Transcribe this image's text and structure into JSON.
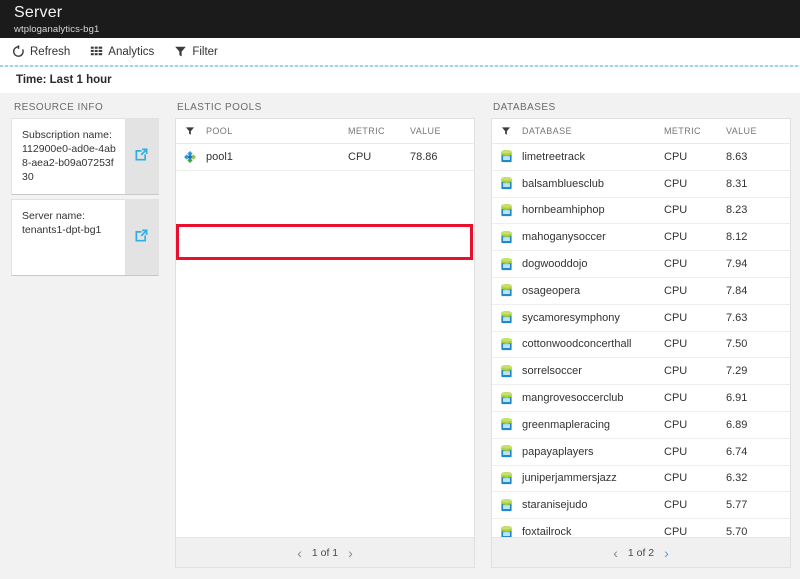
{
  "header": {
    "title": "Server",
    "subtitle": "wtploganalytics-bg1"
  },
  "toolbar": {
    "refresh_label": "Refresh",
    "analytics_label": "Analytics",
    "filter_label": "Filter"
  },
  "timebar": {
    "time_label": "Time: Last 1 hour"
  },
  "resource_info": {
    "section_title": "RESOURCE INFO",
    "cards": [
      {
        "label": "Subscription name:",
        "value": "112900e0-ad0e-4ab8-aea2-b09a07253f30",
        "action_icon": "external-link-icon"
      },
      {
        "label": "Server name:",
        "value": "tenants1-dpt-bg1",
        "action_icon": "external-link-icon"
      }
    ]
  },
  "elastic_pools": {
    "section_title": "ELASTIC POOLS",
    "columns": [
      "POOL",
      "METRIC",
      "VALUE"
    ],
    "filter_icon": "filter-icon",
    "rows": [
      {
        "icon": "elastic-pool-icon",
        "name": "pool1",
        "metric": "CPU",
        "value": "78.86"
      }
    ],
    "pager": {
      "prev_icon": "chevron-left-icon",
      "label": "1 of 1",
      "next_icon": "chevron-right-icon"
    },
    "highlight_color": "#e8112d"
  },
  "databases": {
    "section_title": "DATABASES",
    "columns": [
      "DATABASE",
      "METRIC",
      "VALUE"
    ],
    "filter_icon": "filter-icon",
    "rows": [
      {
        "icon": "database-icon",
        "name": "limetreetrack",
        "metric": "CPU",
        "value": "8.63"
      },
      {
        "icon": "database-icon",
        "name": "balsambluesclub",
        "metric": "CPU",
        "value": "8.31"
      },
      {
        "icon": "database-icon",
        "name": "hornbeamhiphop",
        "metric": "CPU",
        "value": "8.23"
      },
      {
        "icon": "database-icon",
        "name": "mahoganysoccer",
        "metric": "CPU",
        "value": "8.12"
      },
      {
        "icon": "database-icon",
        "name": "dogwooddojo",
        "metric": "CPU",
        "value": "7.94"
      },
      {
        "icon": "database-icon",
        "name": "osageopera",
        "metric": "CPU",
        "value": "7.84"
      },
      {
        "icon": "database-icon",
        "name": "sycamoresymphony",
        "metric": "CPU",
        "value": "7.63"
      },
      {
        "icon": "database-icon",
        "name": "cottonwoodconcerthall",
        "metric": "CPU",
        "value": "7.50"
      },
      {
        "icon": "database-icon",
        "name": "sorrelsoccer",
        "metric": "CPU",
        "value": "7.29"
      },
      {
        "icon": "database-icon",
        "name": "mangrovesoccerclub",
        "metric": "CPU",
        "value": "6.91"
      },
      {
        "icon": "database-icon",
        "name": "greenmapleracing",
        "metric": "CPU",
        "value": "6.89"
      },
      {
        "icon": "database-icon",
        "name": "papayaplayers",
        "metric": "CPU",
        "value": "6.74"
      },
      {
        "icon": "database-icon",
        "name": "juniperjammersjazz",
        "metric": "CPU",
        "value": "6.32"
      },
      {
        "icon": "database-icon",
        "name": "staranisejudo",
        "metric": "CPU",
        "value": "5.77"
      },
      {
        "icon": "database-icon",
        "name": "foxtailrock",
        "metric": "CPU",
        "value": "5.70"
      }
    ],
    "pager": {
      "prev_icon": "chevron-left-icon",
      "label": "1 of 2",
      "next_icon": "chevron-right-icon"
    }
  }
}
